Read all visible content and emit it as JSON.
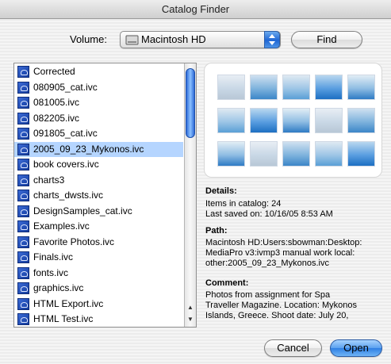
{
  "window": {
    "title": "Catalog Finder"
  },
  "volume": {
    "label": "Volume:",
    "selected": "Macintosh HD",
    "icon": "hard-drive-icon"
  },
  "buttons": {
    "find": "Find",
    "cancel": "Cancel",
    "open": "Open"
  },
  "catalog_list": {
    "selected_index": 5,
    "items": [
      "Corrected",
      "080905_cat.ivc",
      "081005.ivc",
      "082205.ivc",
      "091805_cat.ivc",
      "2005_09_23_Mykonos.ivc",
      "book covers.ivc",
      "charts3",
      "charts_dwsts.ivc",
      "DesignSamples_cat.ivc",
      "Examples.ivc",
      "Favorite Photos.ivc",
      "Finals.ivc",
      "fonts.ivc",
      "graphics.ivc",
      "HTML Export.ivc",
      "HTML Test.ivc"
    ]
  },
  "preview": {
    "thumbnail_count": 15
  },
  "details": {
    "title": "Details:",
    "items_line": "Items in catalog: 24",
    "saved_line": "Last saved on: 10/16/05 8:53 AM"
  },
  "path": {
    "title": "Path:",
    "lines": [
      "Macintosh HD:Users:sbowman:Desktop:",
      "MediaPro v3:ivmp3 manual work local:",
      "other:2005_09_23_Mykonos.ivc"
    ]
  },
  "comment": {
    "title": "Comment:",
    "lines": [
      "Photos from assignment for Spa",
      "Traveller Magazine. Location: Mykonos",
      "Islands, Greece. Shoot date: July 20,"
    ]
  },
  "colors": {
    "selection": "#b5d5ff",
    "accent": "#2f7fe3"
  }
}
